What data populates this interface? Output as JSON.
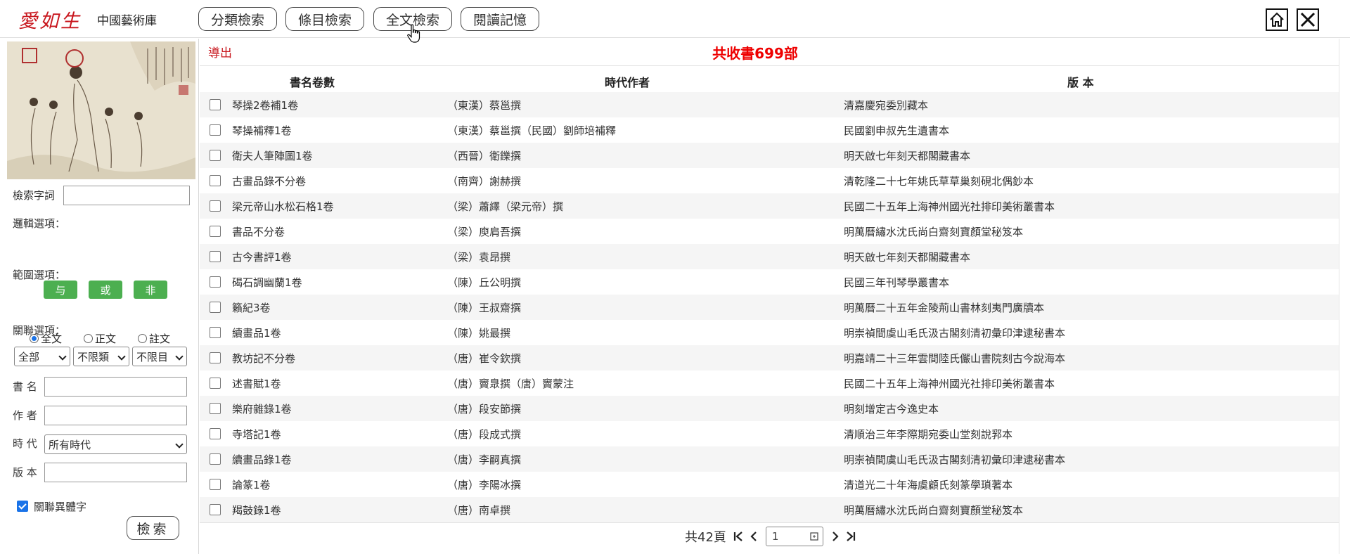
{
  "header": {
    "logo": "愛如生",
    "subtitle": "中國藝術庫",
    "nav": [
      "分類檢索",
      "條目檢索",
      "全文檢索",
      "閱讀記憶"
    ]
  },
  "sidebar": {
    "search_term_label": "檢索字詞",
    "logic_label": "邏輯選項：",
    "logic_buttons": [
      "与",
      "或",
      "非"
    ],
    "scope_label": "範圍選項：",
    "scope_options": [
      "全文",
      "正文",
      "註文"
    ],
    "relation_label": "關聯選項：",
    "relation_selects": [
      "全部",
      "不限類",
      "不限目"
    ],
    "book_label": "書 名",
    "author_label": "作 者",
    "era_label": "時 代",
    "era_value": "所有時代",
    "edition_label": "版 本",
    "variant_label": "關聯異體字",
    "search_button": "檢索"
  },
  "main": {
    "export": "導出",
    "total": "共收書699部",
    "columns": [
      "書名卷數",
      "時代作者",
      "版 本"
    ],
    "rows": [
      [
        "琴操2卷補1卷",
        "（東漢）蔡邕撰",
        "清嘉慶宛委別藏本"
      ],
      [
        "琴操補釋1卷",
        "（東漢）蔡邕撰（民國）劉師培補釋",
        "民國劉申叔先生遺書本"
      ],
      [
        "衛夫人筆陣圖1卷",
        "（西晉）衛鑠撰",
        "明天啟七年刻天都閣藏書本"
      ],
      [
        "古畫品錄不分卷",
        "（南齊）謝赫撰",
        "清乾隆二十七年姚氏草草巢刻硯北偶鈔本"
      ],
      [
        "梁元帝山水松石格1卷",
        "（梁）蕭繹（梁元帝）撰",
        "民國二十五年上海神州國光社排印美術叢書本"
      ],
      [
        "書品不分卷",
        "（梁）庾肩吾撰",
        "明萬曆繡水沈氏尚白齋刻寶顏堂秘笈本"
      ],
      [
        "古今書評1卷",
        "（梁）袁昂撰",
        "明天啟七年刻天都閣藏書本"
      ],
      [
        "碣石調幽蘭1卷",
        "（陳）丘公明撰",
        "民國三年刊琴學叢書本"
      ],
      [
        "籟紀3卷",
        "（陳）王叔齋撰",
        "明萬曆二十五年金陵荊山書林刻夷門廣牘本"
      ],
      [
        "續畫品1卷",
        "（陳）姚最撰",
        "明崇禎間虞山毛氏汲古閣刻清初彙印津逮秘書本"
      ],
      [
        "教坊記不分卷",
        "（唐）崔令欽撰",
        "明嘉靖二十三年雲間陸氏儼山書院刻古今說海本"
      ],
      [
        "述書賦1卷",
        "（唐）竇臮撰（唐）竇蒙注",
        "民國二十五年上海神州國光社排印美術叢書本"
      ],
      [
        "樂府雜錄1卷",
        "（唐）段安節撰",
        "明刻增定古今逸史本"
      ],
      [
        "寺塔記1卷",
        "（唐）段成式撰",
        "清順治三年李際期宛委山堂刻說郛本"
      ],
      [
        "續畫品錄1卷",
        "（唐）李嗣真撰",
        "明崇禎間虞山毛氏汲古閣刻清初彙印津逮秘書本"
      ],
      [
        "論篆1卷",
        "（唐）李陽冰撰",
        "清道光二十年海虞顧氏刻篆學瑣著本"
      ],
      [
        "羯鼓錄1卷",
        "（唐）南卓撰",
        "明萬曆繡水沈氏尚白齋刻寶顏堂秘笈本"
      ]
    ],
    "pager": {
      "total_pages": "共42頁",
      "current_page": "1"
    }
  }
}
